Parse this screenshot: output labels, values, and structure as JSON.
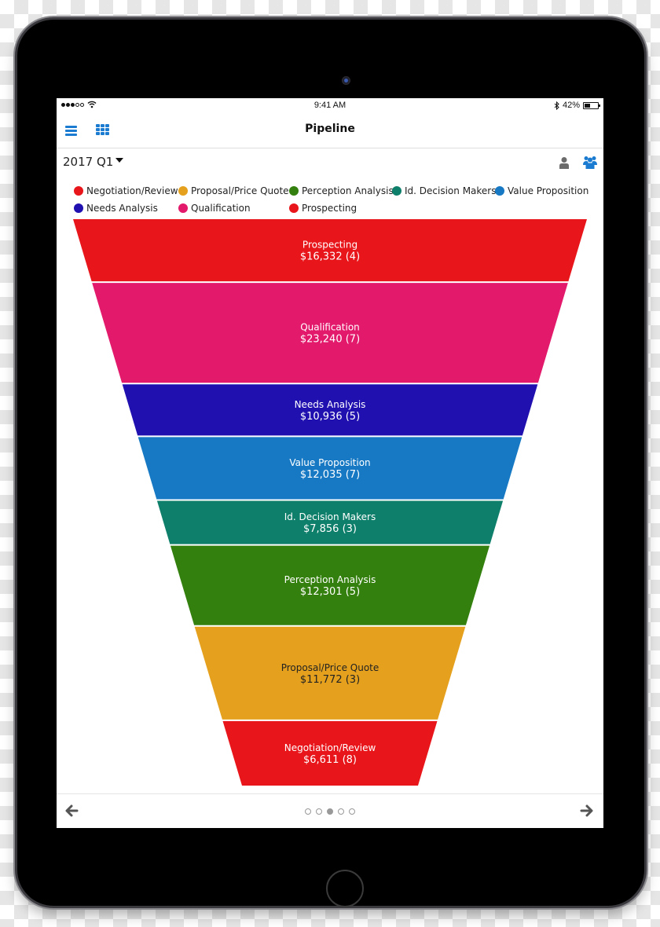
{
  "status_bar": {
    "time": "9:41 AM",
    "battery_percent_label": "42%",
    "battery_level": 0.42,
    "signal_bars_filled": 3,
    "signal_bars_total": 5,
    "icons": [
      "wifi-icon",
      "bluetooth-icon",
      "battery-icon"
    ]
  },
  "nav": {
    "title": "Pipeline",
    "left_icons": [
      "menu-icon",
      "grid-icon"
    ]
  },
  "period": {
    "selected": "2017 Q1",
    "right_icons": [
      "user-icon",
      "team-icon"
    ]
  },
  "colors": {
    "accent": "#1a7bd0",
    "icon_gray": "#6b6b6b"
  },
  "legend": {
    "rows": [
      [
        {
          "label": "Negotiation/Review",
          "color": "#e8161b"
        },
        {
          "label": "Proposal/Price Quote",
          "color": "#e5a11d"
        },
        {
          "label": "Perception Analysis",
          "color": "#34800f"
        },
        {
          "label": "Id. Decision Makers",
          "color": "#0e7f6a"
        },
        {
          "label": "Value Proposition",
          "color": "#1779c3"
        }
      ],
      [
        {
          "label": "Needs Analysis",
          "color": "#2010b0"
        },
        {
          "label": "Qualification",
          "color": "#e3196c"
        },
        {
          "label": "Prospecting",
          "color": "#e8161b"
        }
      ]
    ]
  },
  "chart_data": {
    "type": "funnel",
    "title": "Pipeline",
    "period": "2017 Q1",
    "stages": [
      {
        "name": "Prospecting",
        "value": 16332,
        "count": 4,
        "value_label": "$16,332 (4)",
        "color": "#e8161b",
        "text_color": "#ffffff"
      },
      {
        "name": "Qualification",
        "value": 23240,
        "count": 7,
        "value_label": "$23,240 (7)",
        "color": "#e3196c",
        "text_color": "#ffffff"
      },
      {
        "name": "Needs Analysis",
        "value": 10936,
        "count": 5,
        "value_label": "$10,936 (5)",
        "color": "#2010b0",
        "text_color": "#ffffff"
      },
      {
        "name": "Value Proposition",
        "value": 12035,
        "count": 7,
        "value_label": "$12,035 (7)",
        "color": "#1779c3",
        "text_color": "#ffffff"
      },
      {
        "name": "Id. Decision Makers",
        "value": 7856,
        "count": 3,
        "value_label": "$7,856 (3)",
        "color": "#0e7f6a",
        "text_color": "#ffffff"
      },
      {
        "name": "Perception Analysis",
        "value": 12301,
        "count": 5,
        "value_label": "$12,301 (5)",
        "color": "#34800f",
        "text_color": "#ffffff"
      },
      {
        "name": "Proposal/Price Quote",
        "value": 11772,
        "count": 3,
        "value_label": "$11,772 (3)",
        "color": "#e5a11d",
        "text_color": "#222222"
      },
      {
        "name": "Negotiation/Review",
        "value": 6611,
        "count": 8,
        "value_label": "$6,611 (8)",
        "color": "#e8161b",
        "text_color": "#ffffff"
      }
    ],
    "legend_position": "top"
  },
  "pagination": {
    "total_pages": 5,
    "current_page": 3
  }
}
